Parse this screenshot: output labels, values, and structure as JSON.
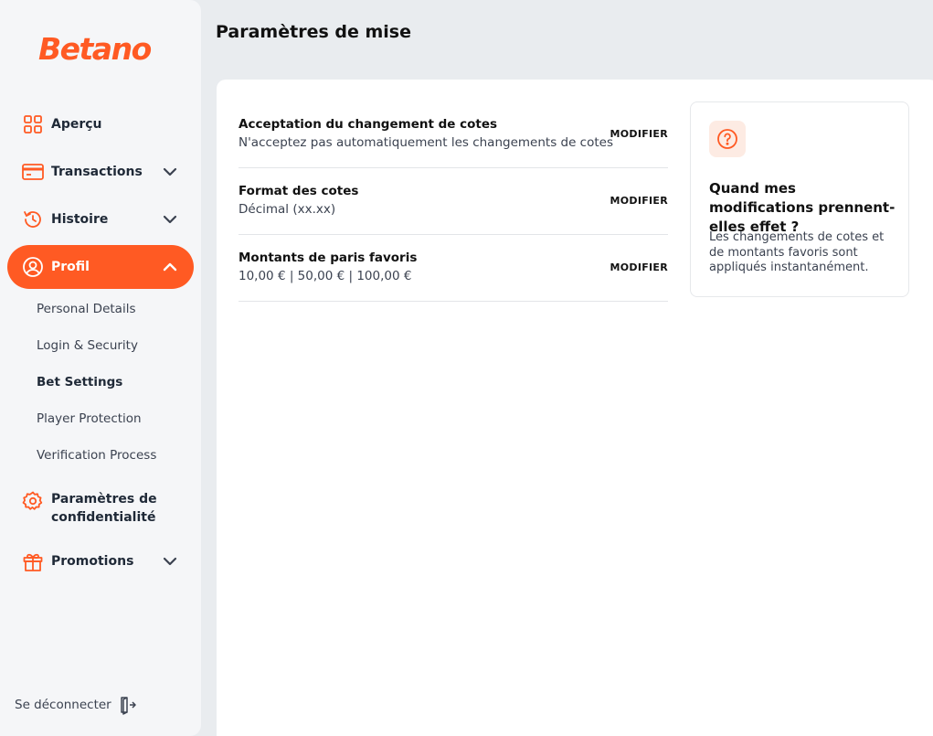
{
  "brand": {
    "logo_text": "Betano",
    "accent": "#ff5a23"
  },
  "sidebar": {
    "items": [
      {
        "label": "Aperçu",
        "icon": "grid-icon"
      },
      {
        "label": "Transactions",
        "icon": "card-icon",
        "chevron": "down"
      },
      {
        "label": "Histoire",
        "icon": "history-icon",
        "chevron": "down"
      },
      {
        "label": "Profil",
        "icon": "user-icon",
        "chevron": "up",
        "active": true
      },
      {
        "label": "Paramètres de confidentialité",
        "icon": "gear-icon"
      },
      {
        "label": "Promotions",
        "icon": "gift-icon",
        "chevron": "down"
      }
    ],
    "profile_subitems": [
      {
        "label": "Personal Details"
      },
      {
        "label": "Login & Security"
      },
      {
        "label": "Bet Settings",
        "active": true
      },
      {
        "label": "Player Protection"
      },
      {
        "label": "Verification Process"
      }
    ],
    "logout_label": "Se déconnecter"
  },
  "page": {
    "title": "Paramètres de mise"
  },
  "settings": [
    {
      "title": "Acceptation du changement de cotes",
      "value": "N'acceptez pas automatiquement les changements de cotes",
      "action": "MODIFIER"
    },
    {
      "title": "Format des cotes",
      "value": "Décimal (xx.xx)",
      "action": "MODIFIER"
    },
    {
      "title": "Montants de paris favoris",
      "value": "10,00 € | 50,00 € | 100,00 €",
      "action": "MODIFIER"
    }
  ],
  "info": {
    "icon": "question-circle-icon",
    "title": "Quand mes modifications prennent-elles effet ?",
    "text": "Les changements de cotes et de montants favoris sont appliqués instantanément."
  }
}
